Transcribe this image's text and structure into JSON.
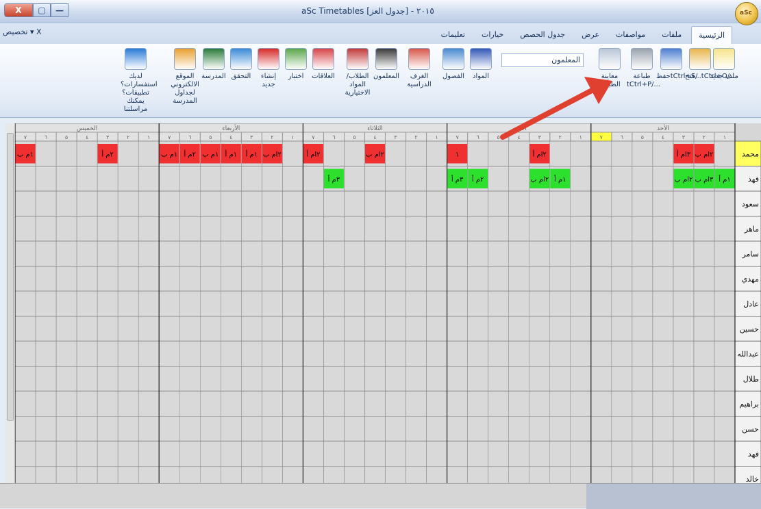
{
  "window": {
    "title": "aSc Timetables ٢٠١٥ - [جدول العز]",
    "close": "X",
    "restore": "▢",
    "minimize": "—",
    "orb_label": "aSc"
  },
  "customize": "تخصيص ▾ X",
  "tabs": [
    "الرئيسية",
    "ملفات",
    "مواصفات",
    "عرض",
    "جدول الحصص",
    "خيارات",
    "تعليمات"
  ],
  "ribbon": {
    "teacher_select": "المعلمون",
    "buttons": [
      {
        "id": "new",
        "label": "ملف جديد",
        "color": "#f7e58a"
      },
      {
        "id": "open",
        "label": "فتح...tCtrl+O/",
        "color": "#e8b54c"
      },
      {
        "id": "save",
        "label": "حفظtCtrl+S/",
        "color": "#4f7fd0"
      },
      {
        "id": "print",
        "label": "طباعة tCtrl+P/...",
        "color": "#9aa3ad"
      },
      {
        "id": "preview",
        "label": "معاينة الطباعة",
        "color": "#b9c6d6"
      },
      {
        "id": "subjects",
        "label": "المواد",
        "color": "#3458b8"
      },
      {
        "id": "classes",
        "label": "الفصول",
        "color": "#4a8ad0"
      },
      {
        "id": "rooms",
        "label": "الغرف الدراسية",
        "color": "#d8584a"
      },
      {
        "id": "teachers",
        "label": "المعلمون",
        "color": "#3a3a3a"
      },
      {
        "id": "students",
        "label": "الطلاب/ المواد الاختيارية",
        "color": "#c23a3a"
      },
      {
        "id": "relations",
        "label": "العلاقات",
        "color": "#d8464a"
      },
      {
        "id": "test",
        "label": "اختبار",
        "color": "#5aa84a"
      },
      {
        "id": "generate",
        "label": "إنشاء جديد",
        "color": "#d82a2a"
      },
      {
        "id": "check",
        "label": "التحقق",
        "color": "#3a8ad8"
      },
      {
        "id": "school",
        "label": "المدرسة",
        "color": "#2a7a3a"
      },
      {
        "id": "website",
        "label": "الموقع الالكتروني لجداول المدرسة",
        "color": "#e8a030"
      },
      {
        "id": "help",
        "label": "لديك استفسارات؟ تطبيقات؟ يمكنك مراسلتنا",
        "color": "#2a7ad8"
      }
    ]
  },
  "days": [
    "الأحد",
    "الاثنين",
    "الثلاثاء",
    "الأربعاء",
    "الخميس"
  ],
  "periods": [
    "١",
    "٢",
    "٣",
    "٤",
    "٥",
    "٦",
    "٧"
  ],
  "teachers": [
    "محمد",
    "فهد",
    "سعود",
    "ماهر",
    "سامر",
    "مهدي",
    "عادل",
    "حسين",
    "عبدالله",
    "طلال",
    "براهيم",
    "حسن",
    "فهد",
    "خالد"
  ],
  "teacher_colors": [
    "#f03030",
    "#2ee02e",
    "#2030e0",
    "#f8c8f8",
    "#ffff80",
    "#f06060",
    "#ffc060",
    "#90f090",
    "#80ffff",
    "#20a040",
    "#ccffcc",
    "#6a9a10",
    "#6a6af0",
    "#70e870"
  ],
  "schedule": [
    [
      "",
      "٢ام ب",
      "٣ام أ",
      "",
      "",
      "",
      "",
      "",
      "",
      "٢ام أ",
      "",
      "",
      "",
      "١",
      "",
      "",
      "",
      "٢ام ب",
      "",
      "",
      "٢ام أ",
      "",
      "٢ام ب",
      "١م أ",
      "١م أ",
      "١م ب",
      "٢م أ",
      "١م ب",
      "",
      "",
      "٢م أ",
      "",
      "",
      "",
      "١م ب",
      "١م ب",
      "٢م ب",
      "",
      "",
      "",
      "",
      "١م ب",
      "",
      "",
      ""
    ],
    [
      "١م أ",
      "٣ام ب",
      "٢ام ب",
      "",
      "",
      "",
      "",
      "",
      "١م أ",
      "٢ام ب",
      "",
      "",
      "٢م أ",
      "٣م أ",
      "",
      "",
      "",
      "",
      "",
      "٣م أ",
      "",
      "",
      "",
      "",
      "",
      "",
      "",
      "",
      "",
      "",
      "",
      "",
      "",
      "",
      "",
      "",
      "",
      "",
      "",
      "",
      "",
      ""
    ],
    [
      "",
      "",
      "",
      "",
      "",
      "",
      "",
      "",
      "",
      "",
      "",
      "",
      "",
      "",
      "",
      "",
      "",
      "",
      "",
      "",
      "",
      "",
      "",
      "",
      "",
      "",
      "",
      "",
      "",
      "",
      "",
      "",
      "",
      "",
      "",
      "",
      "",
      "",
      "",
      "",
      "",
      "",
      "",
      "",
      "",
      "",
      "",
      "",
      ""
    ]
  ],
  "status": {
    "left": "",
    "right": ""
  }
}
